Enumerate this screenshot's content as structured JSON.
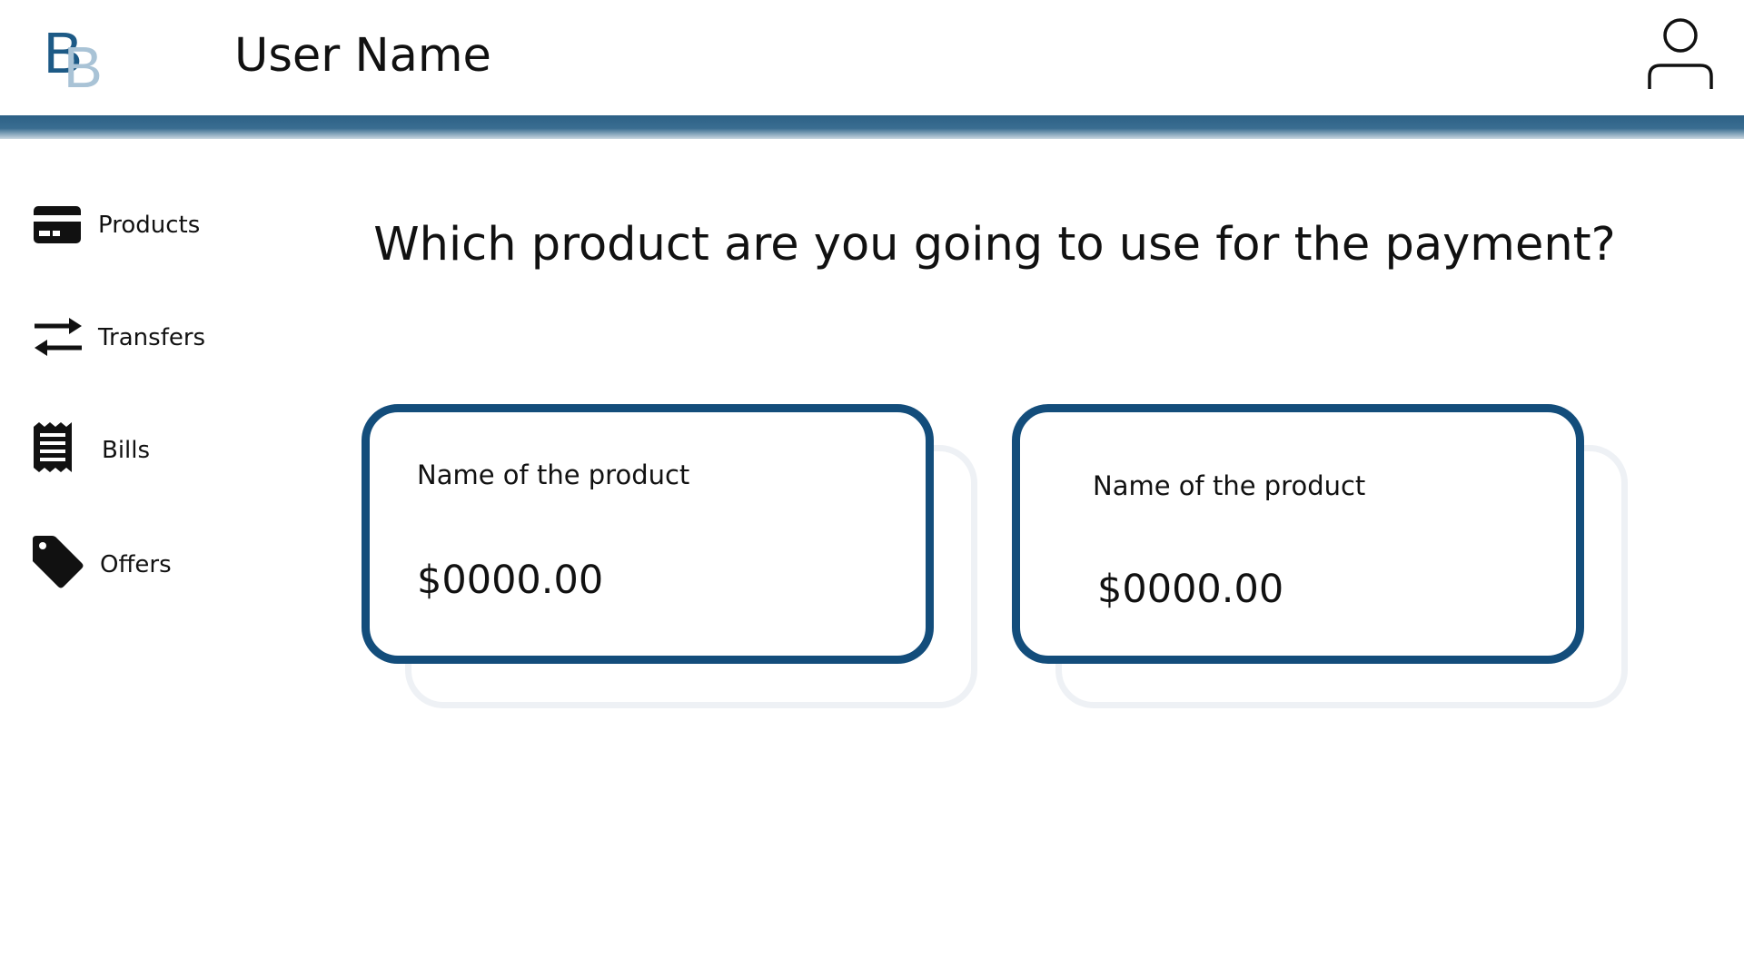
{
  "header": {
    "logo_letter_primary": "B",
    "logo_letter_secondary": "B",
    "user_name": "User Name",
    "profile_icon": "user-icon"
  },
  "sidebar": {
    "items": [
      {
        "label": "Products",
        "icon": "credit-card-icon"
      },
      {
        "label": "Transfers",
        "icon": "transfer-arrows-icon"
      },
      {
        "label": "Bills",
        "icon": "receipt-icon"
      },
      {
        "label": "Offers",
        "icon": "tag-icon"
      }
    ]
  },
  "main": {
    "question": "Which product are you going to use for the payment?",
    "products": [
      {
        "name": "Name of the product",
        "amount": "$0000.00"
      },
      {
        "name": "Name of the product",
        "amount": "$0000.00"
      }
    ]
  },
  "colors": {
    "accent": "#134d7b",
    "header_bar": "#2c6186",
    "logo_primary": "#1d5a86",
    "logo_secondary": "#a9c3d6",
    "card_shadow": "#eef1f5"
  }
}
